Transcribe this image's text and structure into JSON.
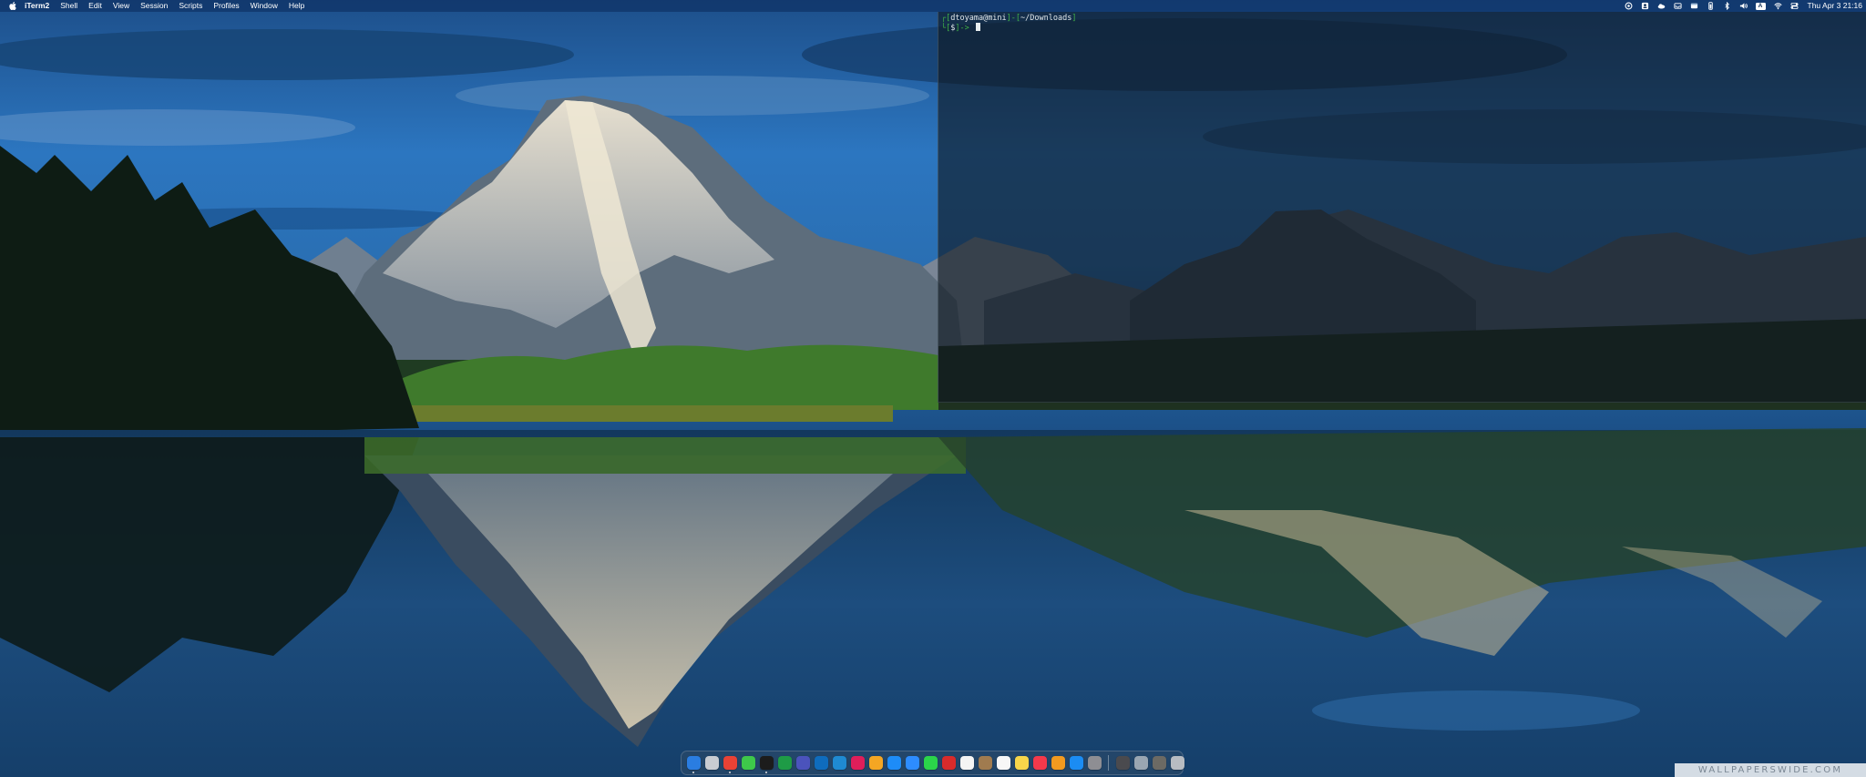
{
  "menubar": {
    "apple_icon": "apple-logo-icon",
    "menus": [
      "iTerm2",
      "Shell",
      "Edit",
      "View",
      "Session",
      "Scripts",
      "Profiles",
      "Window",
      "Help"
    ],
    "status_icons": [
      "screen-capture-icon",
      "contacts-icon",
      "cloud-drive-icon",
      "tray-icon",
      "window-icon",
      "battery-icon",
      "bluetooth-icon",
      "volume-icon"
    ],
    "input_source": "A",
    "status_icons_right": [
      "wifi-icon",
      "control-center-icon"
    ],
    "clock": "Thu Apr 3  21:16"
  },
  "terminal": {
    "bracket_open": "┌",
    "bracket_close": "└",
    "user_host": "dtoyama@mini",
    "path": "~/Downloads",
    "prompt_symbol": "$",
    "prompt_arrow": "->"
  },
  "dock": {
    "apps": [
      {
        "name": "finder",
        "color": "#2a7de1"
      },
      {
        "name": "launchpad",
        "color": "#c9ccd2"
      },
      {
        "name": "chrome",
        "color": "#e94235"
      },
      {
        "name": "messages",
        "color": "#3ec84a"
      },
      {
        "name": "terminal",
        "color": "#1c1c1c"
      },
      {
        "name": "numbers",
        "color": "#1e9b46"
      },
      {
        "name": "teams",
        "color": "#4b53bc"
      },
      {
        "name": "outlook",
        "color": "#0f6cbd"
      },
      {
        "name": "vscode",
        "color": "#1f8ad2"
      },
      {
        "name": "slack",
        "color": "#e01e5a"
      },
      {
        "name": "photos",
        "color": "#f5a623"
      },
      {
        "name": "mail",
        "color": "#1d8cf8"
      },
      {
        "name": "zoom",
        "color": "#2d8cff"
      },
      {
        "name": "facetime",
        "color": "#2bd44a"
      },
      {
        "name": "record",
        "color": "#d92b2b"
      },
      {
        "name": "calendar",
        "color": "#f4f4f4"
      },
      {
        "name": "contacts",
        "color": "#a07b4f"
      },
      {
        "name": "reminders",
        "color": "#f7f7f7"
      },
      {
        "name": "notes",
        "color": "#f7d54a"
      },
      {
        "name": "news",
        "color": "#f5394b"
      },
      {
        "name": "pages",
        "color": "#f39a1f"
      },
      {
        "name": "app-store",
        "color": "#1b8cf3"
      },
      {
        "name": "settings",
        "color": "#8e8e93"
      }
    ],
    "right_apps": [
      {
        "name": "screenshot",
        "color": "#4a4a4e"
      },
      {
        "name": "preview",
        "color": "#9aa6b2"
      },
      {
        "name": "downloads-stack",
        "color": "#6c6a64"
      },
      {
        "name": "trash",
        "color": "#b8bcc2"
      }
    ]
  },
  "watermark": "WALLPAPERSWIDE.COM"
}
